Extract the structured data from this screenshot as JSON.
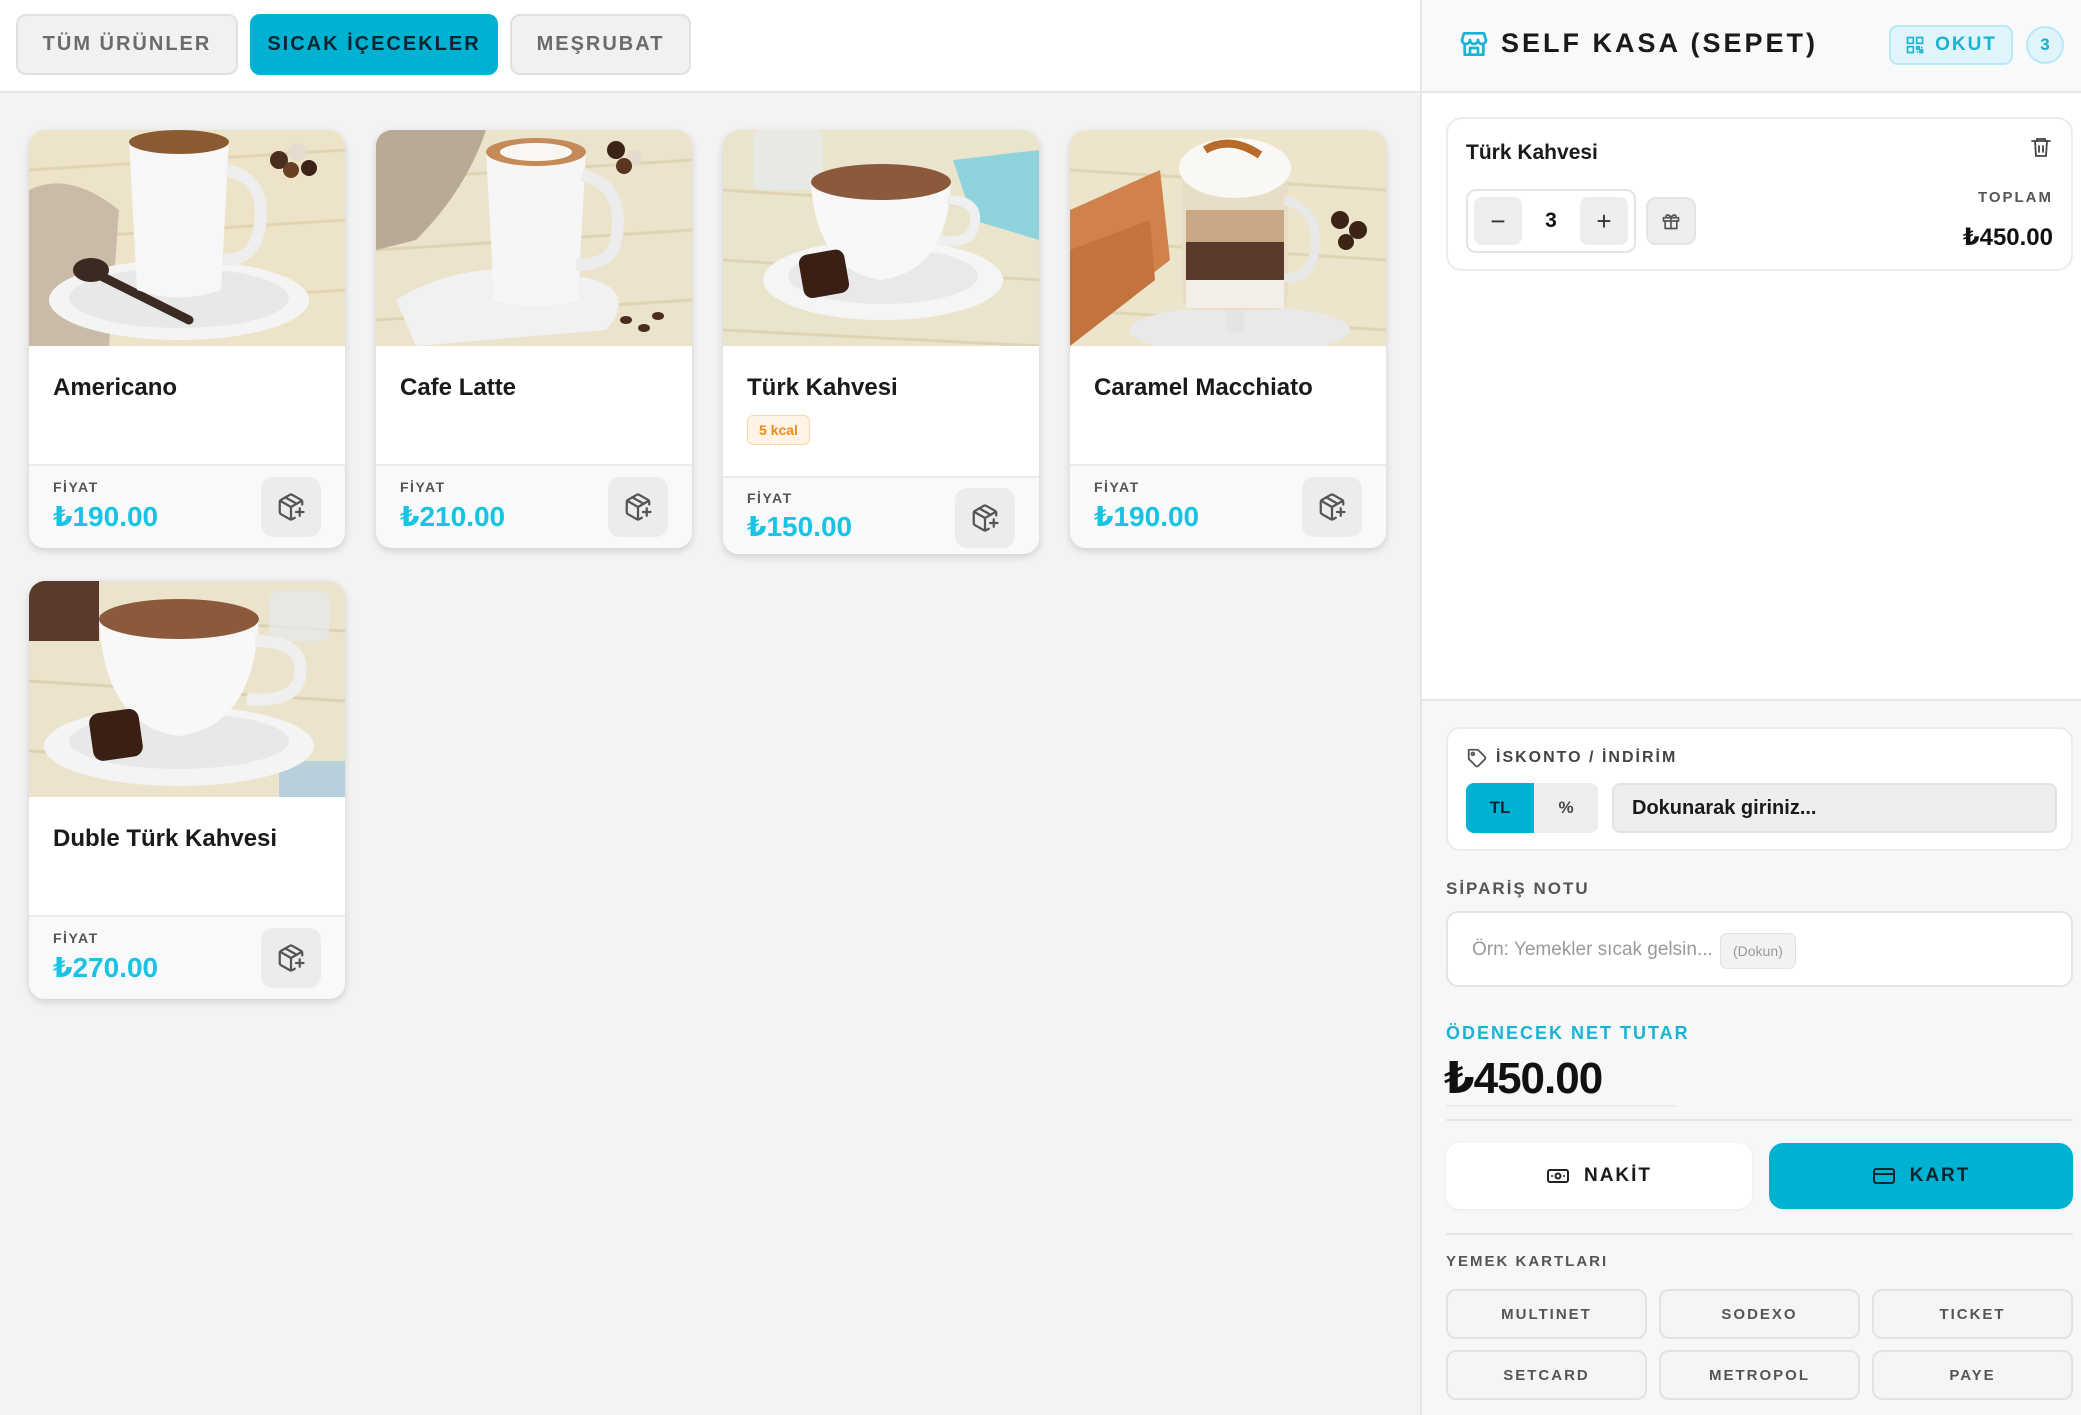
{
  "categories": {
    "all": "TÜM ÜRÜNLER",
    "hot": "SICAK İÇECEKLER",
    "soft": "MEŞRUBAT"
  },
  "products": [
    {
      "name": "Americano",
      "price_label": "FİYAT",
      "price": "₺190.00"
    },
    {
      "name": "Cafe Latte",
      "price_label": "FİYAT",
      "price": "₺210.00"
    },
    {
      "name": "Türk Kahvesi",
      "kcal": "5 kcal",
      "price_label": "FİYAT",
      "price": "₺150.00"
    },
    {
      "name": "Caramel Macchiato",
      "price_label": "FİYAT",
      "price": "₺190.00"
    },
    {
      "name": "Duble Türk Kahvesi",
      "price_label": "FİYAT",
      "price": "₺270.00"
    }
  ],
  "cart": {
    "title": "SELF KASA (SEPET)",
    "scan_label": "OKUT",
    "count": "3",
    "items": [
      {
        "name": "Türk Kahvesi",
        "qty": "3",
        "total_label": "TOPLAM",
        "total": "₺450.00"
      }
    ],
    "minus": "−",
    "plus": "+"
  },
  "discount": {
    "title": "İSKONTO / İNDİRİM",
    "tl": "TL",
    "pct": "%",
    "input_value": "Dokunarak giriniz..."
  },
  "note": {
    "label": "SİPARİŞ NOTU",
    "placeholder": "Örn: Yemekler sıcak gelsin...",
    "chip": "(Dokun)"
  },
  "net": {
    "label": "ÖDENECEK NET TUTAR",
    "amount": "₺450.00"
  },
  "payment": {
    "cash": "NAKİT",
    "card": "KART"
  },
  "meal_cards": {
    "label": "YEMEK KARTLARI",
    "items": [
      "MULTINET",
      "SODEXO",
      "TICKET",
      "SETCARD",
      "METROPOL",
      "PAYE"
    ]
  },
  "colors": {
    "accent": "#00b2d2",
    "price": "#19c3e3",
    "kcal": "#f08a1c"
  }
}
